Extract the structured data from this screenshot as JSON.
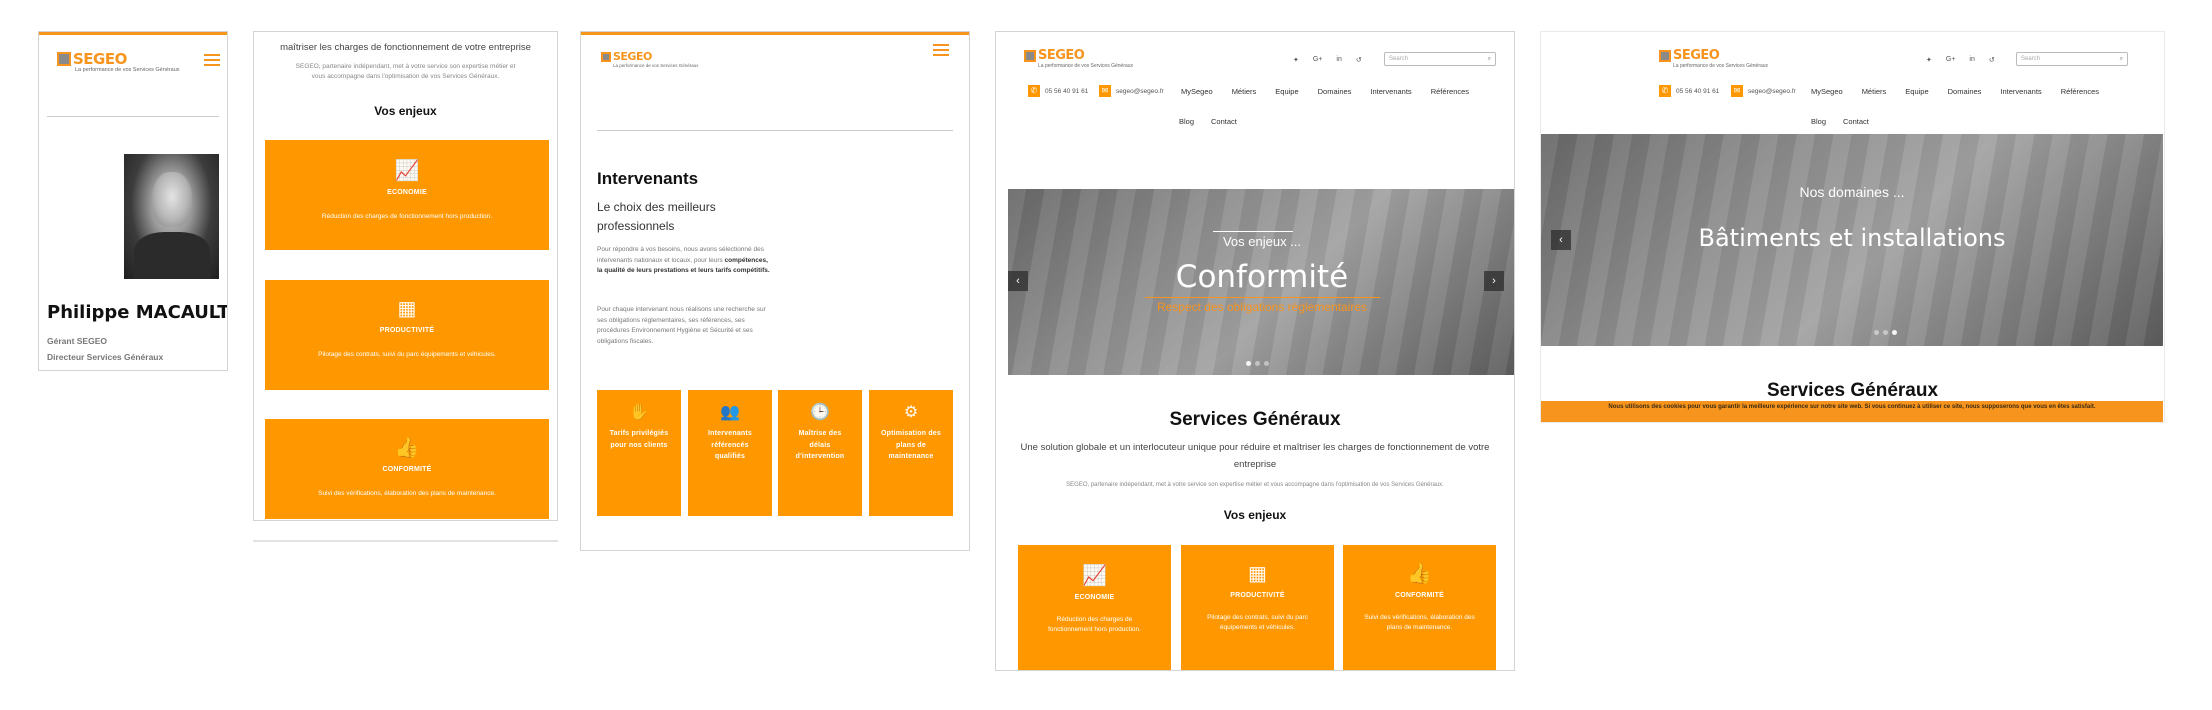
{
  "brand": {
    "name": "SEGEO",
    "tagline": "La performance de vos Services Généraux",
    "accent": "#f7941d",
    "card_color": "#ff9800"
  },
  "panel1": {
    "name": "Philippe MACAULT",
    "role1": "Gérant SEGEO",
    "role2": "Directeur Services Généraux",
    "icons": {
      "menu": "hamburger-icon",
      "photo": "portrait-photo"
    }
  },
  "panel2": {
    "intro_top": "maîtriser les charges de fonctionnement de votre entreprise",
    "intro_desc": "SEGEO, partenaire indépendant, met à votre service son expertise métier et vous accompagne dans l'optimisation de vos Services Généraux.",
    "section": "Vos enjeux",
    "cards": [
      {
        "icon": "chart-icon",
        "title": "ECONOMIE",
        "desc": "Réduction des charges de fonctionnement hors production."
      },
      {
        "icon": "blocks-icon",
        "title": "PRODUCTIVITÉ",
        "desc": "Pilotage des contrats, suivi du parc équipements et véhicules."
      },
      {
        "icon": "thumbs-up-icon",
        "title": "CONFORMITÉ",
        "desc": "Suivi des vérifications, élaboration des plans de maintenance."
      }
    ]
  },
  "panel3": {
    "title": "Intervenants",
    "subtitle": "Le choix des meilleurs professionnels",
    "p1_a": "Pour répondre à vos besoins, nous avons sélectionné des intervenants nationaux et locaux, pour leurs ",
    "p1_b": "compétences, la qualité de leurs prestations et leurs tarifs compétitifs.",
    "p2": "Pour chaque intervenant nous réalisons une recherche sur ses obligations réglementaires, ses références, ses procédures Environnement Hygiène et Sécurité et ses obligations fiscales.",
    "cards": [
      {
        "icon": "hand-icon",
        "label": "Tarifs privilégiés pour nos clients"
      },
      {
        "icon": "people-icon",
        "label": "Intervenants référencés qualifiés"
      },
      {
        "icon": "clock-icon",
        "label": "Maîtrise des délais d'intervention"
      },
      {
        "icon": "gears-icon",
        "label": "Optimisation des plans de maintenance"
      }
    ]
  },
  "panel4": {
    "phone": "05 56 40 91 61",
    "email": "segeo@segeo.fr",
    "search_placeholder": "Search",
    "nav": [
      "MySegeo",
      "Métiers",
      "Equipe",
      "Domaines",
      "Intervenants",
      "Références"
    ],
    "nav2": [
      "Blog",
      "Contact"
    ],
    "social": [
      "twitter-icon",
      "google-plus-icon",
      "linkedin-icon",
      "viadeo-icon"
    ],
    "social_glyphs": [
      "✦",
      "G+",
      "in",
      "↺"
    ],
    "hero_kicker": "Vos enjeux ...",
    "hero_title": "Conformité",
    "hero_sub": "Respect des obligations réglementaires",
    "heading": "Services Généraux",
    "lead": "Une solution globale et un interlocuteur unique pour réduire et maîtriser les charges de fonctionnement de votre entreprise",
    "small": "SEGEO, partenaire indépendant, met à votre service son expertise métier et vous accompagne dans l'optimisation de vos Services Généraux.",
    "section": "Vos enjeux",
    "cards": [
      {
        "icon": "chart-icon",
        "title": "ECONOMIE",
        "desc": "Réduction des charges de fonctionnement hors production."
      },
      {
        "icon": "blocks-icon",
        "title": "PRODUCTIVITÉ",
        "desc": "Pilotage des contrats, suivi du parc équipements et véhicules."
      },
      {
        "icon": "thumbs-up-icon",
        "title": "CONFORMITÉ",
        "desc": "Suivi des vérifications, élaboration des plans de maintenance."
      }
    ]
  },
  "panel5": {
    "phone": "05 56 40 91 61",
    "email": "segeo@segeo.fr",
    "search_placeholder": "Search",
    "nav": [
      "MySegeo",
      "Métiers",
      "Equipe",
      "Domaines",
      "Intervenants",
      "Références"
    ],
    "nav2": [
      "Blog",
      "Contact"
    ],
    "hero_kicker": "Nos domaines ...",
    "hero_title": "Bâtiments et installations",
    "heading": "Services Généraux",
    "cookie": "Nous utilisons des cookies pour vous garantir la meilleure expérience sur notre site web. Si vous continuez à utiliser ce site, nous supposerons que vous en êtes satisfait."
  }
}
